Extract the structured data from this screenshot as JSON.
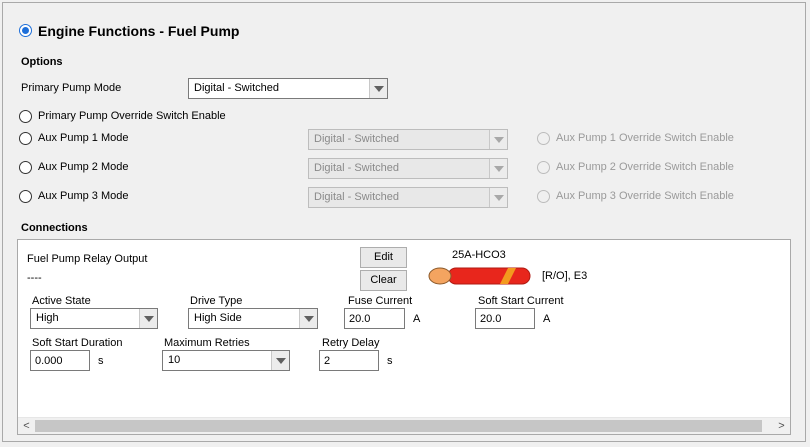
{
  "header": {
    "title": "Engine Functions - Fuel Pump",
    "enabled": true
  },
  "options": {
    "section_label": "Options",
    "primary_mode_label": "Primary Pump Mode",
    "primary_mode_value": "Digital - Switched",
    "primary_override_label": "Primary Pump Override Switch Enable",
    "aux": [
      {
        "mode_label": "Aux Pump 1 Mode",
        "mode_value": "Digital - Switched",
        "override_label": "Aux Pump 1 Override Switch Enable"
      },
      {
        "mode_label": "Aux Pump 2 Mode",
        "mode_value": "Digital - Switched",
        "override_label": "Aux Pump 2 Override Switch Enable"
      },
      {
        "mode_label": "Aux Pump 3 Mode",
        "mode_value": "Digital - Switched",
        "override_label": "Aux Pump 3 Override Switch Enable"
      }
    ]
  },
  "connections": {
    "section_label": "Connections",
    "relay_title": "Fuel Pump Relay Output",
    "relay_pin": "----",
    "edit_label": "Edit",
    "clear_label": "Clear",
    "wire_code": "25A-HCO3",
    "wire_info": "[R/O], E3",
    "wire_colors": {
      "base": "#e8261c",
      "stripe": "#f39a1e",
      "end": "#f4a460"
    },
    "active_state": {
      "label": "Active State",
      "value": "High"
    },
    "drive_type": {
      "label": "Drive Type",
      "value": "High Side"
    },
    "fuse_current": {
      "label": "Fuse Current",
      "value": "20.0",
      "unit": "A"
    },
    "soft_start_current": {
      "label": "Soft Start Current",
      "value": "20.0",
      "unit": "A"
    },
    "soft_start_duration": {
      "label": "Soft Start Duration",
      "value": "0.000",
      "unit": "s"
    },
    "maximum_retries": {
      "label": "Maximum Retries",
      "value": "10"
    },
    "retry_delay": {
      "label": "Retry Delay",
      "value": "2",
      "unit": "s"
    }
  },
  "scrollbar": {
    "left_arrow": "<",
    "right_arrow": ">"
  }
}
